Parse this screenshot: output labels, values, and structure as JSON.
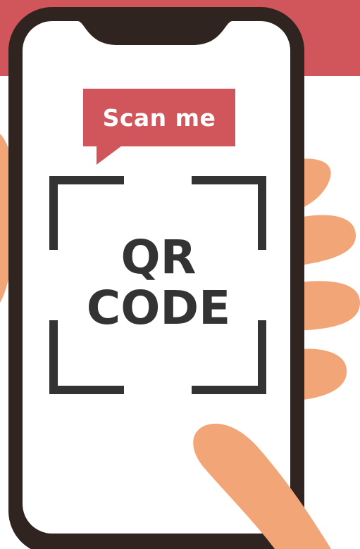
{
  "scene": {
    "bubble_text": "Scan me",
    "code_line_1": "QR",
    "code_line_2": "CODE"
  },
  "colors": {
    "band": "#d0565b",
    "bubble": "#d0565b",
    "phone_frame": "#2f241f",
    "screen": "#ffffff",
    "skin": "#f2a678",
    "frame_corners": "#333333"
  },
  "icons": {
    "hand": "hand-icon",
    "finger": "finger-icon",
    "phone": "smartphone-icon",
    "scan_frame": "scan-frame-icon"
  }
}
